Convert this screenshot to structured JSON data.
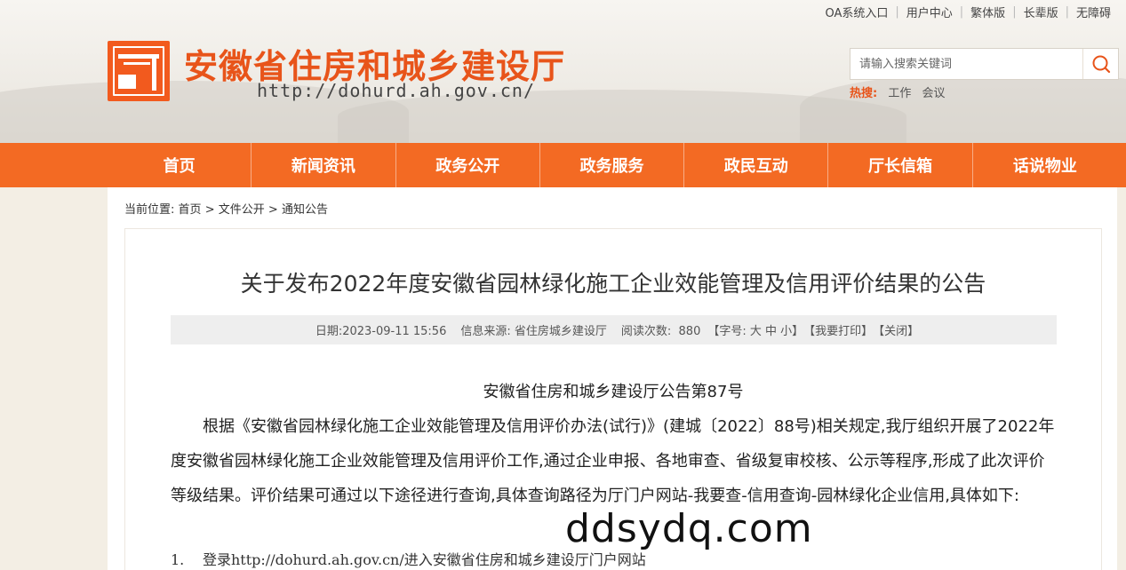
{
  "top_links": [
    "OA系统入口",
    "用户中心",
    "繁体版",
    "长辈版",
    "无障碍"
  ],
  "site": {
    "title": "安徽省住房和城乡建设厅",
    "url": "http://dohurd.ah.gov.cn/"
  },
  "search": {
    "placeholder": "请输入搜索关键词",
    "icon": "search-icon"
  },
  "hot": {
    "label": "热搜:",
    "items": [
      "工作",
      "会议"
    ]
  },
  "nav": [
    "首页",
    "新闻资讯",
    "政务公开",
    "政务服务",
    "政民互动",
    "厅长信箱",
    "话说物业"
  ],
  "breadcrumb": {
    "prefix": "当前位置:",
    "items": [
      "首页",
      "文件公开",
      "通知公告"
    ],
    "sep": ">"
  },
  "article": {
    "title": "关于发布2022年度安徽省园林绿化施工企业效能管理及信用评价结果的公告",
    "meta": {
      "date": "日期:2023-09-11 15:56",
      "source": "信息来源: 省住房城乡建设厅",
      "views_label": "阅读次数:",
      "views": "880",
      "font_size": "【字号: 大 中 小】",
      "print": "【我要打印】",
      "close": "【关闭】"
    },
    "doc_number": "安徽省住房和城乡建设厅公告第87号",
    "paragraph": "根据《安徽省园林绿化施工企业效能管理及信用评价办法(试行)》(建城〔2022〕88号)相关规定,我厅组织开展了2022年度安徽省园林绿化施工企业效能管理及信用评价工作,通过企业申报、各地审查、省级复审校核、公示等程序,形成了此次评价等级结果。评价结果可通过以下途径进行查询,具体查询路径为厅门户网站-我要查-信用查询-园林绿化企业信用,具体如下:",
    "list": [
      {
        "num": "1.",
        "text": "登录http://dohurd.ah.gov.cn/进入安徽省住房和城乡建设厅门户网站"
      }
    ]
  },
  "watermark": "ddsydq.com",
  "colors": {
    "brand": "#e8541a",
    "nav_bg": "#f36a23",
    "page_bg": "#f3eee4"
  }
}
